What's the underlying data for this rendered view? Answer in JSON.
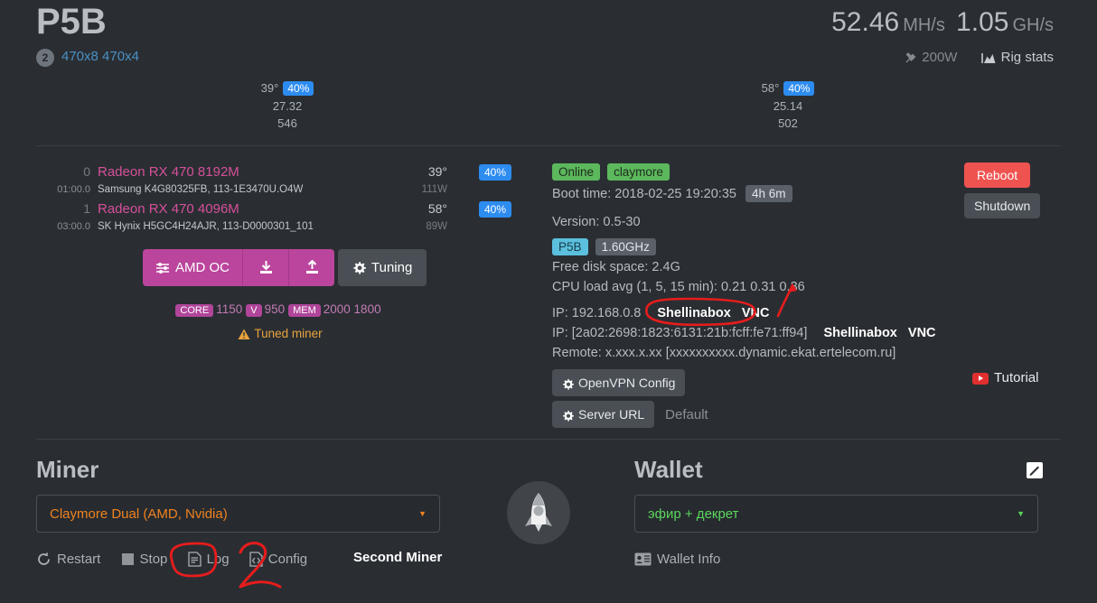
{
  "header": {
    "rig_name": "P5B",
    "gpu_count": "2",
    "tags": "470x8 470x4",
    "hashrate_1_value": "52.46",
    "hashrate_1_unit": "MH/s",
    "hashrate_2_value": "1.05",
    "hashrate_2_unit": "GH/s",
    "power": "200W",
    "rig_stats_label": "Rig stats",
    "power_icon": "plug-icon",
    "rig_stats_icon": "chart-icon"
  },
  "summary_columns": [
    {
      "temp": "39°",
      "fan": "40%",
      "hashrate": "27.32",
      "shares": "546"
    },
    {
      "temp": "58°",
      "fan": "40%",
      "hashrate": "25.14",
      "shares": "502"
    }
  ],
  "gpus": [
    {
      "index": "0",
      "bus": "01:00.0",
      "name": "Radeon RX 470 8192M",
      "memory": "Samsung K4G80325FB, 113-1E3470U.O4W",
      "temp": "39°",
      "watt": "111W",
      "fan": "40%"
    },
    {
      "index": "1",
      "bus": "03:00.0",
      "name": "Radeon RX 470 4096M",
      "memory": "SK Hynix H5GC4H24AJR, 113-D0000301_101",
      "temp": "58°",
      "watt": "89W",
      "fan": "40%"
    }
  ],
  "oc": {
    "amd_oc_label": "AMD OC",
    "amd_oc_icon": "sliders-icon",
    "download_icon": "download-icon",
    "upload_icon": "upload-icon",
    "tuning_label": "Tuning",
    "tuning_icon": "gear-icon",
    "core_label": "CORE",
    "core_value": "1150",
    "v_label": "V",
    "v_value": "950",
    "mem_label": "MEM",
    "mem_value": "2000 1800",
    "tuned_miner_label": "Tuned miner",
    "tuned_miner_icon": "warning-icon"
  },
  "status": {
    "online_badge": "Online",
    "miner_badge": "claymore",
    "boot_time_label": "Boot time: 2018-02-25 19:20:35",
    "uptime_badge": "4h 6m",
    "version_label": "Version: 0.5-30",
    "board_badge": "P5B",
    "cpu_badge": "1.60GHz",
    "disk_label": "Free disk space: 2.4G",
    "cpu_load_label": "CPU load avg (1, 5, 15 min): 0.21 0.31 0.36",
    "ip_v4_label": "IP: 192.168.0.8",
    "ip_v4_shellinabox": "Shellinabox",
    "ip_v4_vnc": "VNC",
    "ip_v6_label": "IP: [2a02:2698:1823:6131:21b:fcff:fe71:ff94]",
    "ip_v6_shellinabox": "Shellinabox",
    "ip_v6_vnc": "VNC",
    "remote_label": "Remote: x.xxx.x.xx [xxxxxxxxxx.dynamic.ekat.ertelecom.ru]",
    "openvpn_label": "OpenVPN Config",
    "openvpn_icon": "gear-icon",
    "server_url_label": "Server URL",
    "server_url_icon": "gear-icon",
    "server_url_value": "Default",
    "reboot_label": "Reboot",
    "shutdown_label": "Shutdown",
    "tutorial_label": "Tutorial",
    "tutorial_icon": "youtube-icon"
  },
  "miner": {
    "section_title": "Miner",
    "selected": "Claymore Dual (AMD, Nvidia)",
    "caret_icon": "chevron-down-icon",
    "restart_label": "Restart",
    "restart_icon": "refresh-icon",
    "stop_label": "Stop",
    "stop_icon": "stop-square-icon",
    "log_label": "Log",
    "log_icon": "document-icon",
    "config_label": "Config",
    "config_icon": "code-file-icon",
    "second_miner_label": "Second Miner"
  },
  "wallet": {
    "section_title": "Wallet",
    "selected": "эфир + декрет",
    "caret_icon": "chevron-down-icon",
    "edit_icon": "pencil-icon",
    "wallet_info_label": "Wallet Info",
    "wallet_info_icon": "id-card-icon"
  },
  "center": {
    "rocket_icon": "rocket-icon"
  },
  "annotations": [
    {
      "name": "ellipse-around-shellinabox-vnc",
      "shape": "ellipse"
    },
    {
      "name": "arrow-pointing-to-shellinabox",
      "shape": "arrow"
    },
    {
      "name": "ellipse-around-log",
      "shape": "ellipse"
    },
    {
      "name": "handwritten-number-2",
      "shape": "digit",
      "text": "2"
    }
  ],
  "colors": {
    "background": "#2a2e33",
    "accent_blue": "#2d8cf0",
    "gpu_pink": "#d6509a",
    "online_green": "#5cb85c",
    "reboot_red": "#ef5350",
    "miner_orange": "#f0831e",
    "wallet_green": "#5cd65c",
    "annotation_red": "#e81c1c",
    "warning_orange": "#e8a33d",
    "oc_magenta": "#bb459c"
  }
}
